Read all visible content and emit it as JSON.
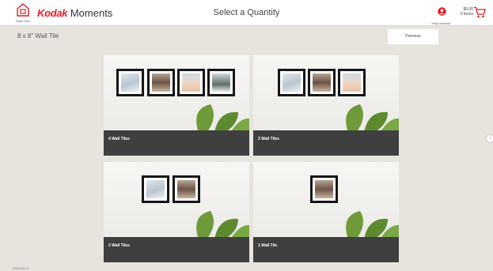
{
  "header": {
    "start_over_label": "Start Over",
    "logo_brand": "Kodak",
    "logo_rest": " Moments",
    "title": "Select a Quantity",
    "help_label": "Help needed?",
    "cart_price": "$0.00",
    "cart_items": "0 items",
    "brand_color": "#e31b23"
  },
  "subheader": {
    "product_name": "8 x 8\" Wall Tile",
    "previous_label": "Previous"
  },
  "options": [
    {
      "label": "4 Wall Tiles",
      "tiles": 4
    },
    {
      "label": "3 Wall Tiles",
      "tiles": 3
    },
    {
      "label": "2 Wall Tiles",
      "tiles": 2
    },
    {
      "label": "1 Wall Tile",
      "tiles": 1
    }
  ],
  "icons": {
    "start_over": "home-icon",
    "help": "user-help-icon",
    "cart": "cart-icon",
    "next": "chevron-right-icon"
  },
  "footer": {
    "text": "ZSWUAL-2"
  }
}
